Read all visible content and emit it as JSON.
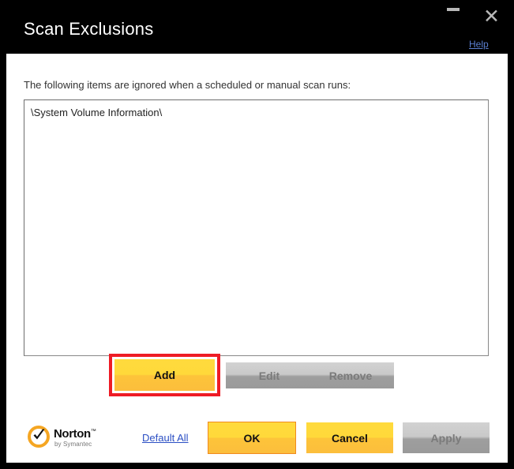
{
  "window": {
    "title": "Scan Exclusions",
    "minimize_label": "minimize",
    "close_label": "✕",
    "help_label": "Help"
  },
  "content": {
    "instruction": "The following items are ignored when a scheduled or manual scan runs:",
    "exclusions": [
      "\\System Volume Information\\"
    ]
  },
  "list_buttons": {
    "add_label": "Add",
    "edit_label": "Edit",
    "remove_label": "Remove"
  },
  "footer": {
    "brand_name": "Norton",
    "brand_tm": "™",
    "brand_sub": "by Symantec",
    "default_all_label": "Default All",
    "ok_label": "OK",
    "cancel_label": "Cancel",
    "apply_label": "Apply"
  },
  "colors": {
    "frame": "#000000",
    "accent_yellow": "#ffd93a",
    "highlight_red": "#ee1c25",
    "focus_orange": "#f08a1e",
    "link_blue": "#2b4fc4",
    "disabled_gray": "#9e9e9e",
    "brand_orange": "#f5a623"
  }
}
